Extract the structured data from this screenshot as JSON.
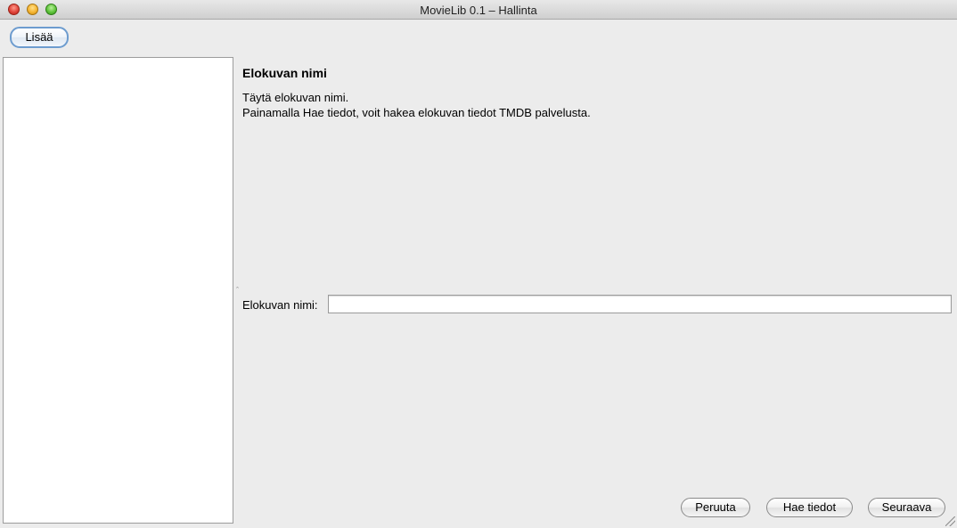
{
  "window": {
    "title": "MovieLib 0.1 – Hallinta"
  },
  "toolbar": {
    "add_label": "Lisää"
  },
  "list": {
    "items": []
  },
  "step": {
    "heading": "Elokuvan nimi",
    "description_line1": "Täytä elokuvan nimi.",
    "description_line2": "Painamalla Hae tiedot, voit hakea elokuvan tiedot TMDB palvelusta."
  },
  "form": {
    "name_label": "Elokuvan nimi:",
    "name_value": ""
  },
  "actions": {
    "cancel_label": "Peruuta",
    "fetch_label": "Hae tiedot",
    "next_label": "Seuraava"
  }
}
